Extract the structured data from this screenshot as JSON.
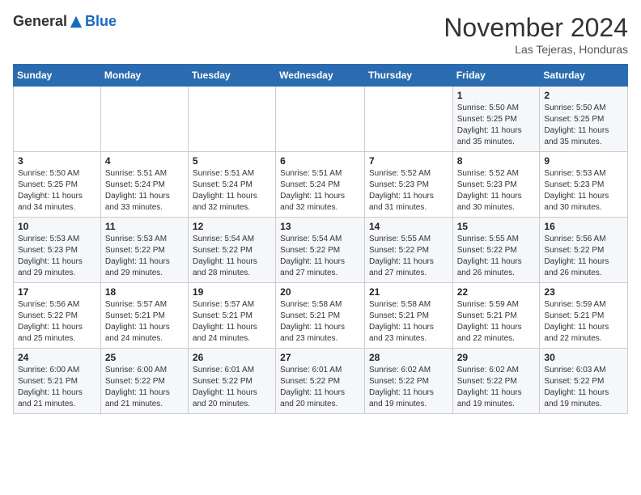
{
  "header": {
    "logo_general": "General",
    "logo_blue": "Blue",
    "month_title": "November 2024",
    "location": "Las Tejeras, Honduras"
  },
  "weekdays": [
    "Sunday",
    "Monday",
    "Tuesday",
    "Wednesday",
    "Thursday",
    "Friday",
    "Saturday"
  ],
  "weeks": [
    [
      {
        "day": "",
        "info": ""
      },
      {
        "day": "",
        "info": ""
      },
      {
        "day": "",
        "info": ""
      },
      {
        "day": "",
        "info": ""
      },
      {
        "day": "",
        "info": ""
      },
      {
        "day": "1",
        "info": "Sunrise: 5:50 AM\nSunset: 5:25 PM\nDaylight: 11 hours\nand 35 minutes."
      },
      {
        "day": "2",
        "info": "Sunrise: 5:50 AM\nSunset: 5:25 PM\nDaylight: 11 hours\nand 35 minutes."
      }
    ],
    [
      {
        "day": "3",
        "info": "Sunrise: 5:50 AM\nSunset: 5:25 PM\nDaylight: 11 hours\nand 34 minutes."
      },
      {
        "day": "4",
        "info": "Sunrise: 5:51 AM\nSunset: 5:24 PM\nDaylight: 11 hours\nand 33 minutes."
      },
      {
        "day": "5",
        "info": "Sunrise: 5:51 AM\nSunset: 5:24 PM\nDaylight: 11 hours\nand 32 minutes."
      },
      {
        "day": "6",
        "info": "Sunrise: 5:51 AM\nSunset: 5:24 PM\nDaylight: 11 hours\nand 32 minutes."
      },
      {
        "day": "7",
        "info": "Sunrise: 5:52 AM\nSunset: 5:23 PM\nDaylight: 11 hours\nand 31 minutes."
      },
      {
        "day": "8",
        "info": "Sunrise: 5:52 AM\nSunset: 5:23 PM\nDaylight: 11 hours\nand 30 minutes."
      },
      {
        "day": "9",
        "info": "Sunrise: 5:53 AM\nSunset: 5:23 PM\nDaylight: 11 hours\nand 30 minutes."
      }
    ],
    [
      {
        "day": "10",
        "info": "Sunrise: 5:53 AM\nSunset: 5:23 PM\nDaylight: 11 hours\nand 29 minutes."
      },
      {
        "day": "11",
        "info": "Sunrise: 5:53 AM\nSunset: 5:22 PM\nDaylight: 11 hours\nand 29 minutes."
      },
      {
        "day": "12",
        "info": "Sunrise: 5:54 AM\nSunset: 5:22 PM\nDaylight: 11 hours\nand 28 minutes."
      },
      {
        "day": "13",
        "info": "Sunrise: 5:54 AM\nSunset: 5:22 PM\nDaylight: 11 hours\nand 27 minutes."
      },
      {
        "day": "14",
        "info": "Sunrise: 5:55 AM\nSunset: 5:22 PM\nDaylight: 11 hours\nand 27 minutes."
      },
      {
        "day": "15",
        "info": "Sunrise: 5:55 AM\nSunset: 5:22 PM\nDaylight: 11 hours\nand 26 minutes."
      },
      {
        "day": "16",
        "info": "Sunrise: 5:56 AM\nSunset: 5:22 PM\nDaylight: 11 hours\nand 26 minutes."
      }
    ],
    [
      {
        "day": "17",
        "info": "Sunrise: 5:56 AM\nSunset: 5:22 PM\nDaylight: 11 hours\nand 25 minutes."
      },
      {
        "day": "18",
        "info": "Sunrise: 5:57 AM\nSunset: 5:21 PM\nDaylight: 11 hours\nand 24 minutes."
      },
      {
        "day": "19",
        "info": "Sunrise: 5:57 AM\nSunset: 5:21 PM\nDaylight: 11 hours\nand 24 minutes."
      },
      {
        "day": "20",
        "info": "Sunrise: 5:58 AM\nSunset: 5:21 PM\nDaylight: 11 hours\nand 23 minutes."
      },
      {
        "day": "21",
        "info": "Sunrise: 5:58 AM\nSunset: 5:21 PM\nDaylight: 11 hours\nand 23 minutes."
      },
      {
        "day": "22",
        "info": "Sunrise: 5:59 AM\nSunset: 5:21 PM\nDaylight: 11 hours\nand 22 minutes."
      },
      {
        "day": "23",
        "info": "Sunrise: 5:59 AM\nSunset: 5:21 PM\nDaylight: 11 hours\nand 22 minutes."
      }
    ],
    [
      {
        "day": "24",
        "info": "Sunrise: 6:00 AM\nSunset: 5:21 PM\nDaylight: 11 hours\nand 21 minutes."
      },
      {
        "day": "25",
        "info": "Sunrise: 6:00 AM\nSunset: 5:22 PM\nDaylight: 11 hours\nand 21 minutes."
      },
      {
        "day": "26",
        "info": "Sunrise: 6:01 AM\nSunset: 5:22 PM\nDaylight: 11 hours\nand 20 minutes."
      },
      {
        "day": "27",
        "info": "Sunrise: 6:01 AM\nSunset: 5:22 PM\nDaylight: 11 hours\nand 20 minutes."
      },
      {
        "day": "28",
        "info": "Sunrise: 6:02 AM\nSunset: 5:22 PM\nDaylight: 11 hours\nand 19 minutes."
      },
      {
        "day": "29",
        "info": "Sunrise: 6:02 AM\nSunset: 5:22 PM\nDaylight: 11 hours\nand 19 minutes."
      },
      {
        "day": "30",
        "info": "Sunrise: 6:03 AM\nSunset: 5:22 PM\nDaylight: 11 hours\nand 19 minutes."
      }
    ]
  ]
}
